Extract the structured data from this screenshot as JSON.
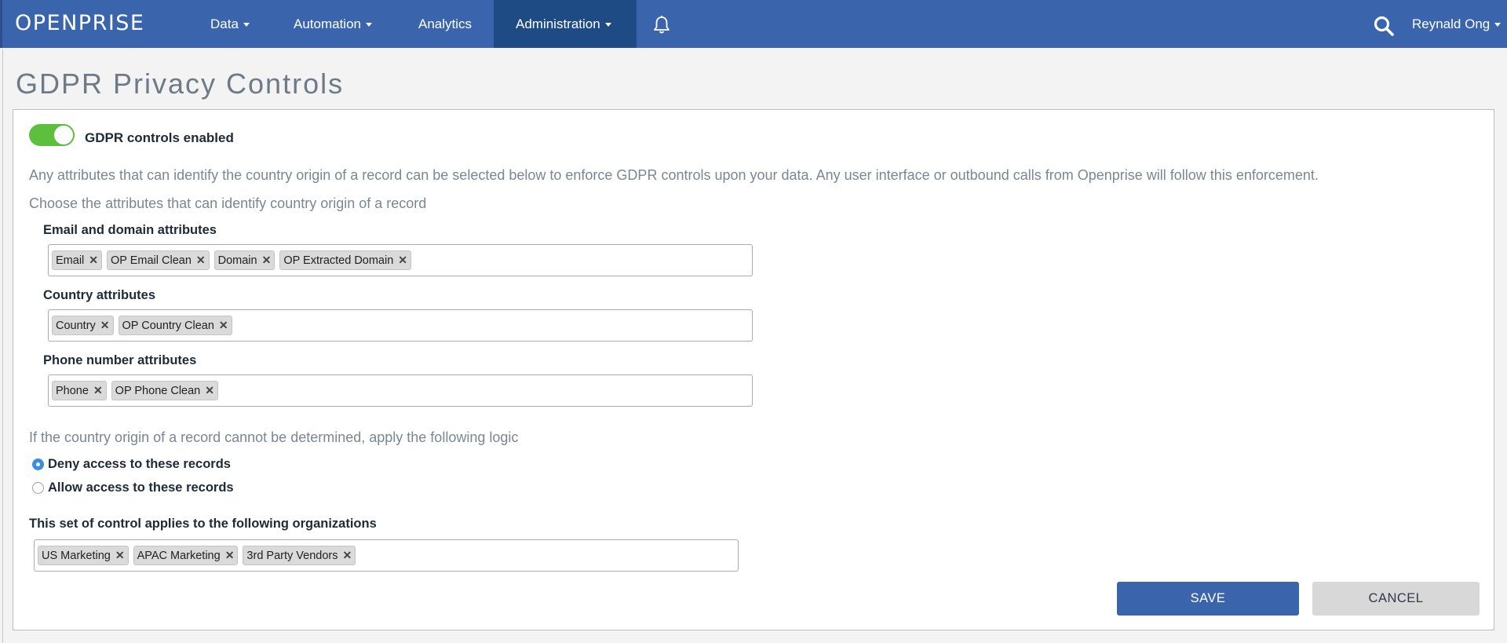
{
  "nav": {
    "logo": "OPENPRISE",
    "items": [
      {
        "label": "Data",
        "dropdown": true
      },
      {
        "label": "Automation",
        "dropdown": true
      },
      {
        "label": "Analytics",
        "dropdown": false
      },
      {
        "label": "Administration",
        "dropdown": true,
        "active": true
      }
    ],
    "bell_icon": "bell-icon",
    "search_icon": "search-icon",
    "user": "Reynald Ong"
  },
  "page": {
    "title": "GDPR Privacy Controls",
    "toggle": {
      "label": "GDPR controls enabled",
      "enabled": true
    },
    "description": "Any attributes that can identify the country origin of a record can be selected below to enforce GDPR controls upon your data. Any user interface or outbound calls from Openprise will follow this enforcement.",
    "choose_label": "Choose the attributes that can identify country origin of a record",
    "email_domain": {
      "label": "Email and domain attributes",
      "tags": [
        "Email",
        "OP Email Clean",
        "Domain",
        "OP Extracted Domain"
      ]
    },
    "country": {
      "label": "Country attributes",
      "tags": [
        "Country",
        "OP Country Clean"
      ]
    },
    "phone": {
      "label": "Phone number attributes",
      "tags": [
        "Phone",
        "OP Phone Clean"
      ]
    },
    "fallback_label": "If the country origin of a record cannot be determined, apply the following logic",
    "radio": {
      "deny": "Deny access to these records",
      "allow": "Allow access to these records",
      "selected": "deny"
    },
    "orgs": {
      "label": "This set of control applies to the following organizations",
      "tags": [
        "US Marketing",
        "APAC Marketing",
        "3rd Party Vendors"
      ]
    },
    "save_label": "SAVE",
    "cancel_label": "CANCEL",
    "tag_remove_glyph": "✕"
  },
  "colors": {
    "nav_bg": "#3a65ad",
    "nav_active": "#1f4b85",
    "toggle_on": "#5cbf3d",
    "save_bg": "#3a65ad",
    "cancel_bg": "#d8d8d8"
  }
}
